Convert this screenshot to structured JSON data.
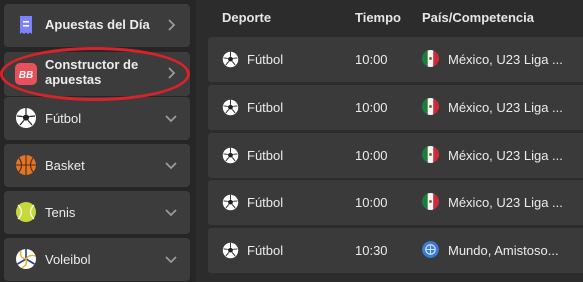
{
  "sidebar": {
    "items": [
      {
        "label": "Apuestas del Día",
        "icon": "receipt-icon",
        "chevron": "right"
      },
      {
        "label_line1": "Constructor de",
        "label_line2": "apuestas",
        "icon": "bet-builder-icon",
        "icon_text": "BB",
        "chevron": "right"
      },
      {
        "label": "Fútbol",
        "icon": "soccer-ball-icon",
        "chevron": "down"
      },
      {
        "label": "Basket",
        "icon": "basketball-icon",
        "chevron": "down"
      },
      {
        "label": "Tenis",
        "icon": "tennis-ball-icon",
        "chevron": "down"
      },
      {
        "label": "Voleibol",
        "icon": "volleyball-icon",
        "chevron": "down"
      }
    ]
  },
  "table": {
    "headers": {
      "sport": "Deporte",
      "time": "Tiempo",
      "country": "País/Competencia"
    },
    "rows": [
      {
        "sport": "Fútbol",
        "time": "10:00",
        "flag": "mexico-flag-icon",
        "competition": "México, U23 Liga ..."
      },
      {
        "sport": "Fútbol",
        "time": "10:00",
        "flag": "mexico-flag-icon",
        "competition": "México, U23 Liga ..."
      },
      {
        "sport": "Fútbol",
        "time": "10:00",
        "flag": "mexico-flag-icon",
        "competition": "México, U23 Liga ..."
      },
      {
        "sport": "Fútbol",
        "time": "10:00",
        "flag": "mexico-flag-icon",
        "competition": "México, U23 Liga ..."
      },
      {
        "sport": "Fútbol",
        "time": "10:30",
        "flag": "world-globe-icon",
        "competition": "Mundo, Amistoso..."
      }
    ]
  },
  "colors": {
    "background": "#2c2c2c",
    "sidebar_item": "#3c3c3c",
    "row": "#3a3a3a",
    "highlight_ring": "#d8232a",
    "bet_builder_badge": "#e8505b"
  }
}
